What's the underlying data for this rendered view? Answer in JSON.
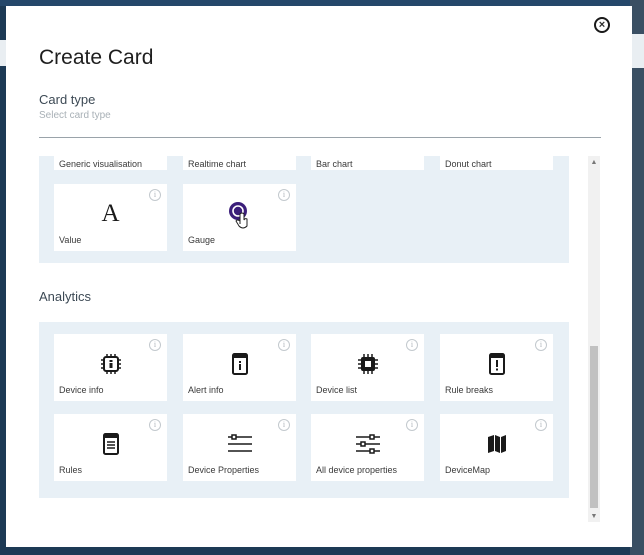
{
  "dialog": {
    "title": "Create Card",
    "close_label": "×",
    "card_type": {
      "label": "Card type",
      "placeholder": "Select card type"
    }
  },
  "visualisation_top_row": [
    "Generic visualisation",
    "Realtime chart",
    "Bar chart",
    "Donut chart"
  ],
  "visualisation_cards": [
    {
      "label": "Value",
      "icon": "letter-a-icon",
      "glyph": "A"
    },
    {
      "label": "Gauge",
      "icon": "gauge-icon"
    }
  ],
  "analytics": {
    "title": "Analytics",
    "cards": [
      {
        "label": "Device info",
        "icon": "chip-info-icon"
      },
      {
        "label": "Alert info",
        "icon": "tablet-info-icon"
      },
      {
        "label": "Device list",
        "icon": "chip-icon"
      },
      {
        "label": "Rule breaks",
        "icon": "tablet-alert-icon"
      },
      {
        "label": "Rules",
        "icon": "document-list-icon"
      },
      {
        "label": "Device Properties",
        "icon": "lines-icon"
      },
      {
        "label": "All device properties",
        "icon": "sliders-icon"
      },
      {
        "label": "DeviceMap",
        "icon": "map-icon"
      }
    ]
  },
  "info_glyph": "i",
  "scrollbar": {
    "up": "▲",
    "down": "▼"
  },
  "colors": {
    "panel_bg": "#e8f0f6",
    "card_bg": "#ffffff",
    "gauge_accent": "#3b1e7a",
    "backdrop": "#1d3a55"
  }
}
